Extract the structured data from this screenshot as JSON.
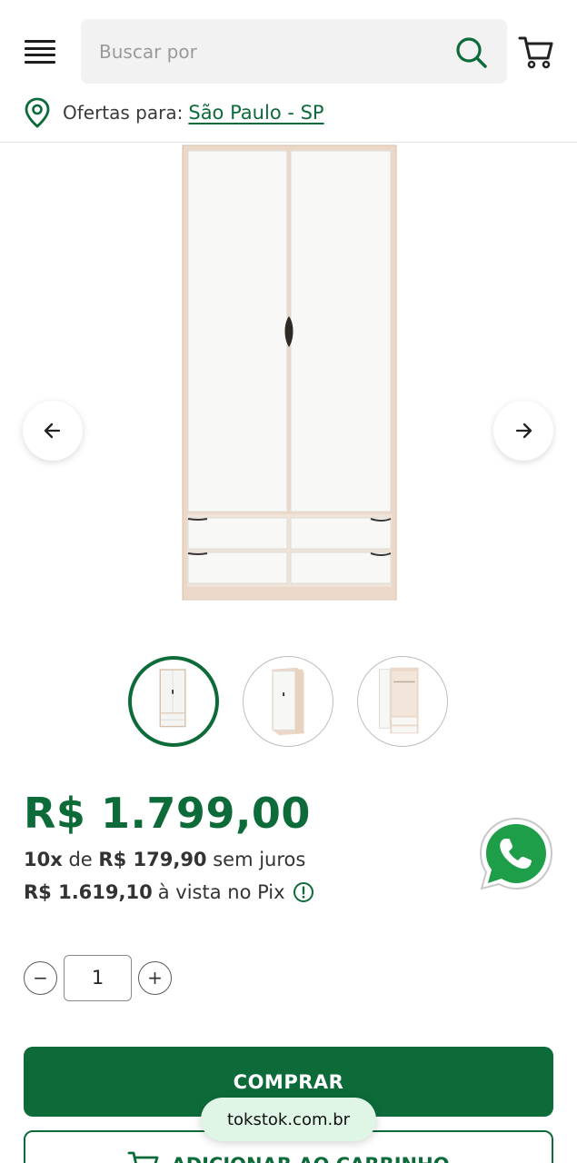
{
  "header": {
    "search_placeholder": "Buscar por",
    "location_label": "Ofertas para:",
    "location_value": "São Paulo - SP"
  },
  "gallery": {
    "prev_label": "←",
    "next_label": "→",
    "thumbnail_count": 3,
    "active_thumbnail": 1
  },
  "pricing": {
    "price": "R$ 1.799,00",
    "installment_count": "10x",
    "installment_of": "de",
    "installment_value": "R$ 179,90",
    "installment_suffix": "sem juros",
    "pix_price": "R$ 1.619,10",
    "pix_suffix": "à vista no Pix"
  },
  "quantity": {
    "minus": "−",
    "value": "1",
    "plus": "+"
  },
  "actions": {
    "buy_label": "COMPRAR",
    "add_cart_label": "ADICIONAR AO CARRINHO"
  },
  "browser": {
    "url": "tokstok.com.br"
  },
  "colors": {
    "brand_green": "#0d6b3a",
    "whatsapp_green": "#1f9e4a"
  }
}
